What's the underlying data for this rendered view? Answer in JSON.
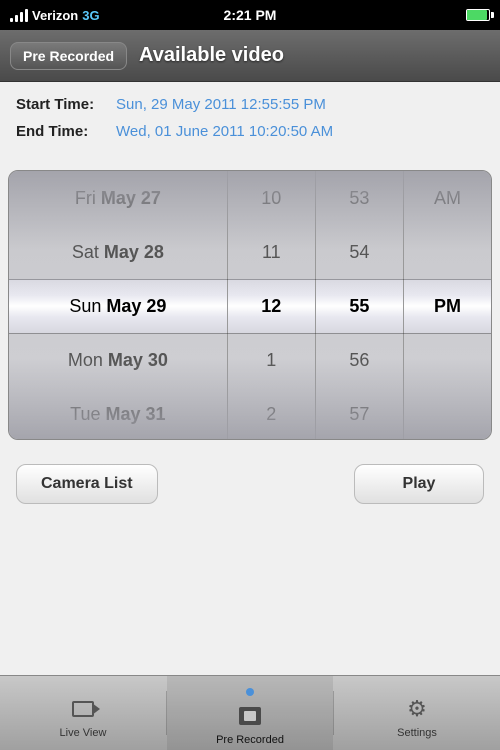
{
  "status_bar": {
    "carrier": "Verizon",
    "network": "3G",
    "time": "2:21 PM",
    "battery_level": 90
  },
  "nav_bar": {
    "badge_label": "Pre Recorded",
    "title": "Available video"
  },
  "info": {
    "start_time_label": "Start Time:",
    "start_time_value": "Sun, 29 May 2011 12:55:55 PM",
    "end_time_label": "End Time:",
    "end_time_value": "Wed, 01 June 2011 10:20:50 AM"
  },
  "picker": {
    "date_items": [
      {
        "day": "Fri",
        "month": "May",
        "date": "27"
      },
      {
        "day": "Sat",
        "month": "May",
        "date": "28"
      },
      {
        "day": "Sun",
        "month": "May",
        "date": "29"
      },
      {
        "day": "Mon",
        "month": "May",
        "date": "30"
      },
      {
        "day": "Tue",
        "month": "May",
        "date": "31"
      }
    ],
    "hour_items": [
      "10",
      "11",
      "12",
      "1",
      "2"
    ],
    "minute_items": [
      "53",
      "54",
      "55",
      "56",
      "57"
    ],
    "ampm_items": [
      "AM",
      "PM",
      "",
      "",
      ""
    ]
  },
  "buttons": {
    "camera_list": "Camera List",
    "play": "Play"
  },
  "tab_bar": {
    "items": [
      {
        "id": "live-view",
        "label": "Live View",
        "icon": "camera"
      },
      {
        "id": "pre-recorded",
        "label": "Pre Recorded",
        "icon": "film",
        "active": true
      },
      {
        "id": "settings",
        "label": "Settings",
        "icon": "gear"
      }
    ]
  }
}
